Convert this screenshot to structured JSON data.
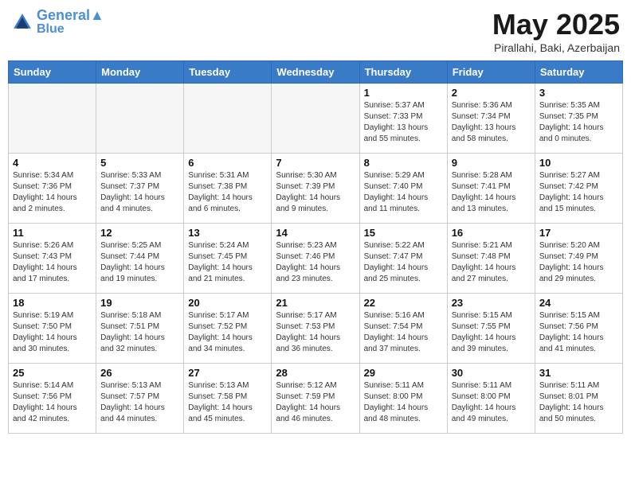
{
  "header": {
    "logo_line1": "General",
    "logo_line2": "Blue",
    "month": "May 2025",
    "location": "Pirallahi, Baki, Azerbaijan"
  },
  "weekdays": [
    "Sunday",
    "Monday",
    "Tuesday",
    "Wednesday",
    "Thursday",
    "Friday",
    "Saturday"
  ],
  "weeks": [
    [
      {
        "day": "",
        "info": ""
      },
      {
        "day": "",
        "info": ""
      },
      {
        "day": "",
        "info": ""
      },
      {
        "day": "",
        "info": ""
      },
      {
        "day": "1",
        "info": "Sunrise: 5:37 AM\nSunset: 7:33 PM\nDaylight: 13 hours\nand 55 minutes."
      },
      {
        "day": "2",
        "info": "Sunrise: 5:36 AM\nSunset: 7:34 PM\nDaylight: 13 hours\nand 58 minutes."
      },
      {
        "day": "3",
        "info": "Sunrise: 5:35 AM\nSunset: 7:35 PM\nDaylight: 14 hours\nand 0 minutes."
      }
    ],
    [
      {
        "day": "4",
        "info": "Sunrise: 5:34 AM\nSunset: 7:36 PM\nDaylight: 14 hours\nand 2 minutes."
      },
      {
        "day": "5",
        "info": "Sunrise: 5:33 AM\nSunset: 7:37 PM\nDaylight: 14 hours\nand 4 minutes."
      },
      {
        "day": "6",
        "info": "Sunrise: 5:31 AM\nSunset: 7:38 PM\nDaylight: 14 hours\nand 6 minutes."
      },
      {
        "day": "7",
        "info": "Sunrise: 5:30 AM\nSunset: 7:39 PM\nDaylight: 14 hours\nand 9 minutes."
      },
      {
        "day": "8",
        "info": "Sunrise: 5:29 AM\nSunset: 7:40 PM\nDaylight: 14 hours\nand 11 minutes."
      },
      {
        "day": "9",
        "info": "Sunrise: 5:28 AM\nSunset: 7:41 PM\nDaylight: 14 hours\nand 13 minutes."
      },
      {
        "day": "10",
        "info": "Sunrise: 5:27 AM\nSunset: 7:42 PM\nDaylight: 14 hours\nand 15 minutes."
      }
    ],
    [
      {
        "day": "11",
        "info": "Sunrise: 5:26 AM\nSunset: 7:43 PM\nDaylight: 14 hours\nand 17 minutes."
      },
      {
        "day": "12",
        "info": "Sunrise: 5:25 AM\nSunset: 7:44 PM\nDaylight: 14 hours\nand 19 minutes."
      },
      {
        "day": "13",
        "info": "Sunrise: 5:24 AM\nSunset: 7:45 PM\nDaylight: 14 hours\nand 21 minutes."
      },
      {
        "day": "14",
        "info": "Sunrise: 5:23 AM\nSunset: 7:46 PM\nDaylight: 14 hours\nand 23 minutes."
      },
      {
        "day": "15",
        "info": "Sunrise: 5:22 AM\nSunset: 7:47 PM\nDaylight: 14 hours\nand 25 minutes."
      },
      {
        "day": "16",
        "info": "Sunrise: 5:21 AM\nSunset: 7:48 PM\nDaylight: 14 hours\nand 27 minutes."
      },
      {
        "day": "17",
        "info": "Sunrise: 5:20 AM\nSunset: 7:49 PM\nDaylight: 14 hours\nand 29 minutes."
      }
    ],
    [
      {
        "day": "18",
        "info": "Sunrise: 5:19 AM\nSunset: 7:50 PM\nDaylight: 14 hours\nand 30 minutes."
      },
      {
        "day": "19",
        "info": "Sunrise: 5:18 AM\nSunset: 7:51 PM\nDaylight: 14 hours\nand 32 minutes."
      },
      {
        "day": "20",
        "info": "Sunrise: 5:17 AM\nSunset: 7:52 PM\nDaylight: 14 hours\nand 34 minutes."
      },
      {
        "day": "21",
        "info": "Sunrise: 5:17 AM\nSunset: 7:53 PM\nDaylight: 14 hours\nand 36 minutes."
      },
      {
        "day": "22",
        "info": "Sunrise: 5:16 AM\nSunset: 7:54 PM\nDaylight: 14 hours\nand 37 minutes."
      },
      {
        "day": "23",
        "info": "Sunrise: 5:15 AM\nSunset: 7:55 PM\nDaylight: 14 hours\nand 39 minutes."
      },
      {
        "day": "24",
        "info": "Sunrise: 5:15 AM\nSunset: 7:56 PM\nDaylight: 14 hours\nand 41 minutes."
      }
    ],
    [
      {
        "day": "25",
        "info": "Sunrise: 5:14 AM\nSunset: 7:56 PM\nDaylight: 14 hours\nand 42 minutes."
      },
      {
        "day": "26",
        "info": "Sunrise: 5:13 AM\nSunset: 7:57 PM\nDaylight: 14 hours\nand 44 minutes."
      },
      {
        "day": "27",
        "info": "Sunrise: 5:13 AM\nSunset: 7:58 PM\nDaylight: 14 hours\nand 45 minutes."
      },
      {
        "day": "28",
        "info": "Sunrise: 5:12 AM\nSunset: 7:59 PM\nDaylight: 14 hours\nand 46 minutes."
      },
      {
        "day": "29",
        "info": "Sunrise: 5:11 AM\nSunset: 8:00 PM\nDaylight: 14 hours\nand 48 minutes."
      },
      {
        "day": "30",
        "info": "Sunrise: 5:11 AM\nSunset: 8:00 PM\nDaylight: 14 hours\nand 49 minutes."
      },
      {
        "day": "31",
        "info": "Sunrise: 5:11 AM\nSunset: 8:01 PM\nDaylight: 14 hours\nand 50 minutes."
      }
    ]
  ]
}
